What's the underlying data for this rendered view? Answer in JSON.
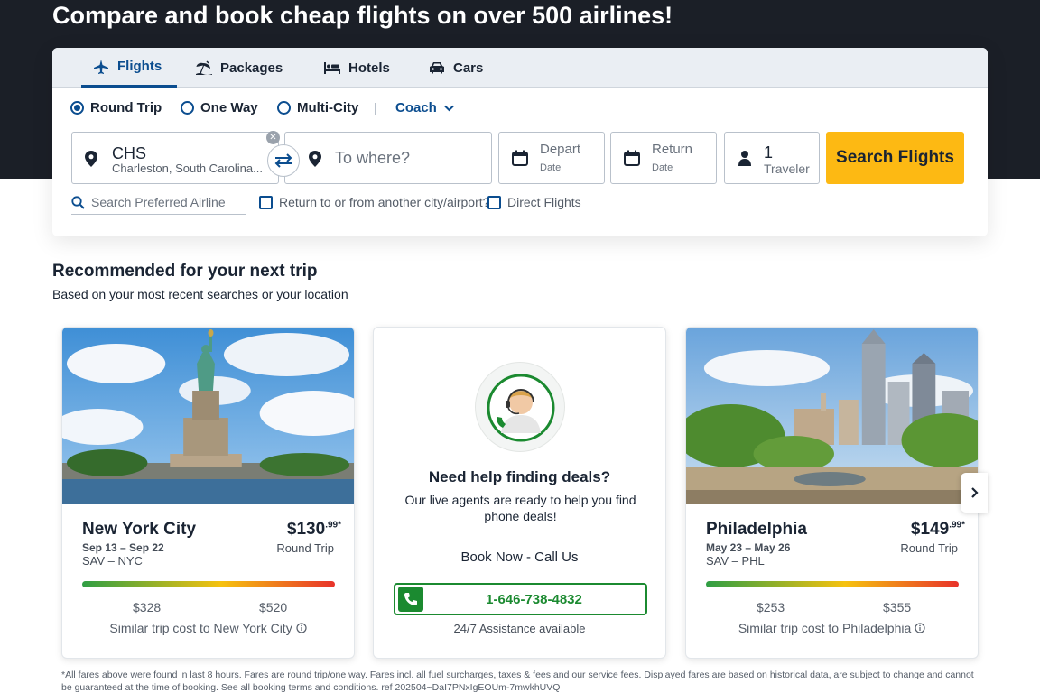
{
  "hero": {
    "title": "Compare and book cheap flights on over 500 airlines!"
  },
  "tabs": [
    {
      "label": "Flights",
      "icon": "plane-icon",
      "active": true
    },
    {
      "label": "Packages",
      "icon": "beach-icon"
    },
    {
      "label": "Hotels",
      "icon": "bed-icon"
    },
    {
      "label": "Cars",
      "icon": "car-icon"
    }
  ],
  "trip_types": [
    {
      "label": "Round Trip",
      "selected": true
    },
    {
      "label": "One Way"
    },
    {
      "label": "Multi-City"
    }
  ],
  "cabin": {
    "selected": "Coach"
  },
  "from": {
    "code": "CHS",
    "city": "Charleston, South Carolina..."
  },
  "to": {
    "placeholder": "To where?"
  },
  "depart": {
    "label": "Depart",
    "sub": "Date"
  },
  "return": {
    "label": "Return",
    "sub": "Date"
  },
  "travelers": {
    "count": "1",
    "label": "Traveler"
  },
  "search_button": "Search Flights",
  "airline_search": {
    "placeholder": "Search Preferred Airline"
  },
  "options": {
    "return_other": "Return to or from another city/airport?",
    "direct": "Direct Flights"
  },
  "recommended": {
    "title": "Recommended for your next trip",
    "subtitle": "Based on your most recent searches or your location"
  },
  "cards": {
    "ny": {
      "city": "New York City",
      "dates": "Sep 13 – Sep 22",
      "route": "SAV – NYC",
      "price_whole": "$130",
      "price_cents": ".99",
      "asterisk": "*",
      "trip_type": "Round Trip",
      "low": "$328",
      "high": "$520",
      "similar": "Similar trip cost to New York City"
    },
    "phl": {
      "city": "Philadelphia",
      "dates": "May 23 – May 26",
      "route": "SAV – PHL",
      "price_whole": "$149",
      "price_cents": ".99",
      "asterisk": "*",
      "trip_type": "Round Trip",
      "low": "$253",
      "high": "$355",
      "similar": "Similar trip cost to Philadelphia"
    }
  },
  "help": {
    "title": "Need help finding deals?",
    "text": "Our live agents are ready to help you find phone deals!",
    "book_now": "Book Now - Call Us",
    "phone": "1-646-738-4832",
    "assist": "24/7 Assistance available"
  },
  "disclaimer": {
    "part1": "*All fares above were found in last 8 hours. Fares are round trip/one way. Fares incl. all fuel surcharges, ",
    "link1": "taxes & fees",
    "and": " and ",
    "link2": "our service fees",
    "part2": ". Displayed fares are based on historical data, are subject to change and cannot be guaranteed at the time of booking. See all booking terms and conditions. ref 202504~DaI7PNxIgEOUm-7mwkhUVQ"
  },
  "colors": {
    "brand_blue": "#0b4d8f",
    "cta_yellow": "#fdb913",
    "phone_green": "#1b8a30",
    "hero_bg": "#1b1f27"
  }
}
